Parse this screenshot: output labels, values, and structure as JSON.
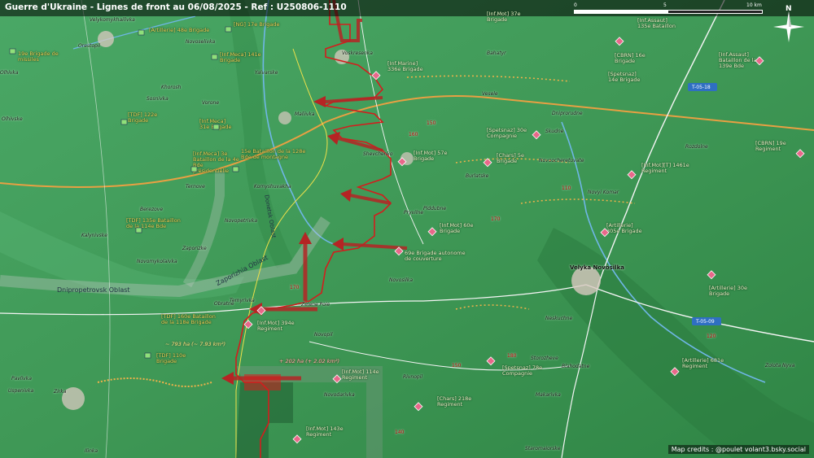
{
  "title": "Guerre d'Ukraine - Lignes de front au 06/08/2025 - Ref : U250806-1110",
  "scale": {
    "start": "0",
    "mid": "5",
    "end": "10 km"
  },
  "compass_label": "N",
  "credits": "Map credits : @poulet volant3.bsky.social",
  "colors": {
    "terrain_green": "#3f9a57",
    "front_red": "#d31d1d",
    "ua_label": "#f5d25a",
    "ru_label": "#f2f2c8"
  },
  "units_ua": [
    {
      "name": "[Artillerie] 48e Brigade"
    },
    {
      "name": "[NG] 17e Brigade"
    },
    {
      "name": "19e Brigade de missiles"
    },
    {
      "name": "[Inf.Meca] 141e Brigade"
    },
    {
      "name": "[TDF] 122e Brigade"
    },
    {
      "name": "[Inf.Meca] 31e Brigade"
    },
    {
      "name": "[Inf.Meca] 3e Bataillon de la 4e Bde présidentielle"
    },
    {
      "name": "15e Bataillon de la 128e Bde de montagne"
    },
    {
      "name": "[TDF] 135e Bataillon de la 114e Bde"
    },
    {
      "name": "[TDF] 160e Bataillon de la 118e Brigade"
    },
    {
      "name": "[TDF] 110e Brigade"
    }
  ],
  "units_ru": [
    {
      "name": "[Inf.Mot] 37e Brigade"
    },
    {
      "name": "[Inf.Assaut] 135e Bataillon"
    },
    {
      "name": "[Inf.Marine] 336e Brigade"
    },
    {
      "name": "[CBRN] 16e Brigade"
    },
    {
      "name": "[Inf.Assaut] Bataillon de la 139e Bde"
    },
    {
      "name": "[Spetsnaz] 14e Brigade"
    },
    {
      "name": "[Spetsnaz] 30e Compagnie"
    },
    {
      "name": "[Inf.Mot] 57e Brigade"
    },
    {
      "name": "[Chars] 5e Brigade"
    },
    {
      "name": "[CBRN] 19e Regiment"
    },
    {
      "name": "[Inf.Mot][T] 1461e Regiment"
    },
    {
      "name": "[Inf.Mot] 60e Brigade"
    },
    {
      "name": "[Artillerie] 305e Brigade"
    },
    {
      "name": "69e Brigade autonome de couverture"
    },
    {
      "name": "[Artillerie] 30e Brigade"
    },
    {
      "name": "[Inf.Mot] 394e Regiment"
    },
    {
      "name": "[Spetsnaz] 78e Compagnie"
    },
    {
      "name": "[Inf.Mot] 114e Regiment"
    },
    {
      "name": "[Artillerie] 681e Regiment"
    },
    {
      "name": "[Chars] 218e Regiment"
    },
    {
      "name": "[Inf.Mot] 143e Regiment"
    }
  ],
  "places": [
    {
      "name": "Velykomykhailivka"
    },
    {
      "name": "Orestopil"
    },
    {
      "name": "Novoselivka"
    },
    {
      "name": "Voskresenka"
    },
    {
      "name": "Yalvarske"
    },
    {
      "name": "Maliivka"
    },
    {
      "name": "Shevchenko"
    },
    {
      "name": "Komyshuvakha"
    },
    {
      "name": "Novopetrivka"
    },
    {
      "name": "Zaporizke"
    },
    {
      "name": "Zelene Pole"
    },
    {
      "name": "Novopil"
    },
    {
      "name": "Temyrivka"
    },
    {
      "name": "Obratne"
    },
    {
      "name": "Novosilka"
    },
    {
      "name": "Velyka Novosilka"
    },
    {
      "name": "Uspenivka"
    },
    {
      "name": "Rivnopil"
    },
    {
      "name": "Novodarivka"
    },
    {
      "name": "Makarivka"
    },
    {
      "name": "Staromaiorske"
    },
    {
      "name": "Zolota Nyva"
    },
    {
      "name": "Skudne"
    },
    {
      "name": "Burlatske"
    },
    {
      "name": "Vesele"
    },
    {
      "name": "Piddubne"
    },
    {
      "name": "Bahatyr"
    },
    {
      "name": "Sosnivka"
    },
    {
      "name": "Kalynivske"
    },
    {
      "name": "Novomykolaivka"
    },
    {
      "name": "Olhivske"
    },
    {
      "name": "Berezove"
    },
    {
      "name": "Ternove"
    },
    {
      "name": "Vorone"
    },
    {
      "name": "Khorosh"
    },
    {
      "name": "Novopetrivka"
    },
    {
      "name": "Dniprorudne"
    },
    {
      "name": "Novoocheretuvate"
    },
    {
      "name": "Neskuchne"
    },
    {
      "name": "Storozheve"
    },
    {
      "name": "Blahodatne"
    },
    {
      "name": "Rozdolne"
    },
    {
      "name": "Novyi Komar"
    },
    {
      "name": "Pryvilne"
    },
    {
      "name": "Pavlivka"
    },
    {
      "name": "Zirka"
    },
    {
      "name": "Olhivka"
    },
    {
      "name": "Uspenivka"
    },
    {
      "name": "Ilinka"
    },
    {
      "name": "Novosilka"
    }
  ],
  "roads": [
    {
      "ref": "T-05-18"
    },
    {
      "ref": "T-05-09"
    }
  ],
  "road_numbers": [
    "160",
    "150",
    "170",
    "110",
    "120",
    "150",
    "140",
    "170",
    "180"
  ],
  "areas": [
    {
      "text": "~ 793 ha (~ 7.93 km²)"
    },
    {
      "text": "+ 202 ha (+ 2.02 km²)"
    }
  ],
  "oblasts": [
    {
      "name": "Dnipropetrovsk Oblast"
    },
    {
      "name": "Zaporizhia Oblast"
    },
    {
      "name": "Donetsk Oblast"
    }
  ]
}
